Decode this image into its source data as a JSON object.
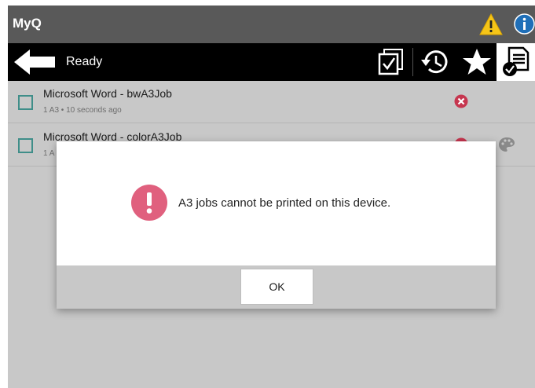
{
  "header": {
    "title": "MyQ",
    "warning_icon": "warning-triangle-icon",
    "info_icon": "info-icon",
    "warning_color": "#f5c518",
    "info_color": "#1f6fb8"
  },
  "toolbar": {
    "status": "Ready",
    "back_icon": "arrow-left-icon",
    "buttons": [
      {
        "icon": "select-all-checkbox-icon"
      },
      {
        "icon": "history-clock-icon"
      },
      {
        "icon": "favorite-star-icon"
      },
      {
        "icon": "ready-jobs-document-icon",
        "active": true
      }
    ]
  },
  "jobs": [
    {
      "name": "Microsoft Word - bwA3Job",
      "meta": "1 A3 • 10 seconds ago",
      "delete_icon": "delete-x-icon"
    },
    {
      "name": "Microsoft Word - colorA3Job",
      "meta": "1 A",
      "delete_icon": "delete-x-icon",
      "color_icon": "palette-icon"
    }
  ],
  "dialog": {
    "icon": "exclamation-circle-icon",
    "icon_color": "#e0607e",
    "message": "A3 jobs cannot be printed on this device.",
    "ok_label": "OK"
  },
  "colors": {
    "checkbox_border": "#3f8e89",
    "delete_color": "#c6364f"
  }
}
